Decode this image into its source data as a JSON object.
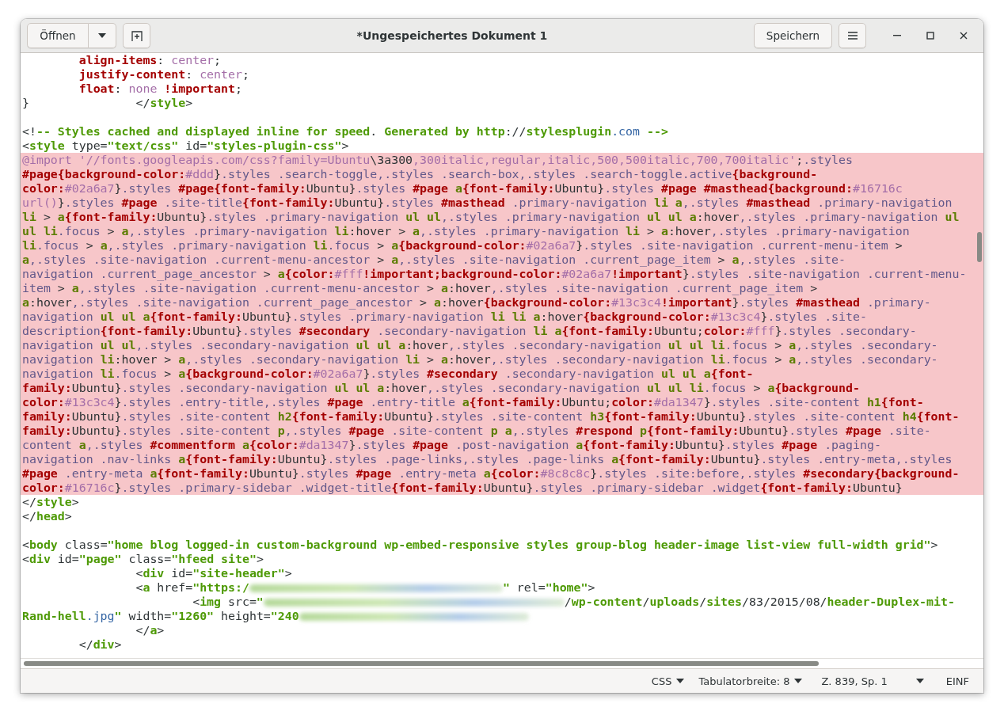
{
  "window": {
    "title": "*Ungespeichertes Dokument 1"
  },
  "header": {
    "open_button": "Öffnen",
    "save_button": "Speichern"
  },
  "editor": {
    "lines": [
      {
        "highlighted": false,
        "segments": [
          {
            "kind": "property",
            "text": "        align-items"
          },
          {
            "kind": "plain",
            "text": ": "
          },
          {
            "kind": "value",
            "text": "center"
          },
          {
            "kind": "plain",
            "text": ";"
          }
        ]
      },
      {
        "highlighted": false,
        "segments": [
          {
            "kind": "property",
            "text": "        justify-content"
          },
          {
            "kind": "plain",
            "text": ": "
          },
          {
            "kind": "value",
            "text": "center"
          },
          {
            "kind": "plain",
            "text": ";"
          }
        ]
      },
      {
        "highlighted": false,
        "segments": [
          {
            "kind": "property",
            "text": "        float"
          },
          {
            "kind": "plain",
            "text": ": "
          },
          {
            "kind": "value",
            "text": "none"
          },
          {
            "kind": "property",
            "text": " !important"
          },
          {
            "kind": "plain",
            "text": ";"
          }
        ]
      },
      {
        "highlighted": false,
        "segments": [
          {
            "kind": "plain",
            "text": "}               </"
          },
          {
            "kind": "markup",
            "text": "style"
          },
          {
            "kind": "plain",
            "text": ">"
          }
        ]
      },
      {
        "highlighted": false
      },
      {
        "highlighted": false,
        "segments": [
          {
            "kind": "plain",
            "text": "<!"
          },
          {
            "kind": "markup",
            "text": "-- Styles cached and displayed inline for speed"
          },
          {
            "kind": "plain",
            "text": "."
          },
          {
            "kind": "markup",
            "text": " Generated by http"
          },
          {
            "kind": "plain",
            "text": "://"
          },
          {
            "kind": "markup",
            "text": "stylesplugin"
          },
          {
            "kind": "link",
            "text": ".com"
          },
          {
            "kind": "markup",
            "text": " -->"
          }
        ]
      },
      {
        "highlighted": false,
        "segments": [
          {
            "kind": "plain",
            "text": "<"
          },
          {
            "kind": "markup",
            "text": "style"
          },
          {
            "kind": "plain",
            "text": " type="
          },
          {
            "kind": "markup",
            "text": "\"text/css\""
          },
          {
            "kind": "plain",
            "text": " id="
          },
          {
            "kind": "markup",
            "text": "\"styles-plugin-css\""
          },
          {
            "kind": "plain",
            "text": ">"
          }
        ]
      },
      {
        "highlighted": true,
        "segments": [
          {
            "kind": "value",
            "text": "@import '//fonts.googleapis.com/css?family=Ubuntu"
          },
          {
            "kind": "plain",
            "text": "\\3a300"
          },
          {
            "kind": "value",
            "text": ",300italic,regular,italic,500,500italic,700,700italic'"
          },
          {
            "kind": "plain",
            "text": ";"
          },
          {
            "kind": "selector",
            "text": ".styles"
          }
        ]
      },
      {
        "highlighted": true,
        "segments": [
          {
            "kind": "property",
            "text": "#page{background-color:"
          },
          {
            "kind": "value",
            "text": "#ddd"
          },
          {
            "kind": "plain",
            "text": "}"
          },
          {
            "kind": "selector",
            "text": ".styles .search-toggle,.styles .search-box,.styles .search-toggle.active"
          },
          {
            "kind": "property",
            "text": "{background-"
          }
        ]
      },
      {
        "highlighted": true,
        "segments": [
          {
            "kind": "property",
            "text": "color:"
          },
          {
            "kind": "value",
            "text": "#02a6a7"
          },
          {
            "kind": "plain",
            "text": "}"
          },
          {
            "kind": "selector",
            "text": ".styles "
          },
          {
            "kind": "property",
            "text": "#page{font-family:"
          },
          {
            "kind": "plain",
            "text": "Ubuntu}"
          },
          {
            "kind": "selector",
            "text": ".styles "
          },
          {
            "kind": "property",
            "text": "#page "
          },
          {
            "kind": "element",
            "text": "a"
          },
          {
            "kind": "property",
            "text": "{font-family:"
          },
          {
            "kind": "plain",
            "text": "Ubuntu}"
          },
          {
            "kind": "selector",
            "text": ".styles "
          },
          {
            "kind": "property",
            "text": "#page #masthead{background:"
          },
          {
            "kind": "value",
            "text": "#16716c"
          }
        ]
      },
      {
        "highlighted": true,
        "segments": [
          {
            "kind": "value",
            "text": "url()"
          },
          {
            "kind": "plain",
            "text": "}"
          },
          {
            "kind": "selector",
            "text": ".styles "
          },
          {
            "kind": "property",
            "text": "#page "
          },
          {
            "kind": "selector",
            "text": ".site-title"
          },
          {
            "kind": "property",
            "text": "{font-family:"
          },
          {
            "kind": "plain",
            "text": "Ubuntu}"
          },
          {
            "kind": "selector",
            "text": ".styles "
          },
          {
            "kind": "property",
            "text": "#masthead "
          },
          {
            "kind": "selector",
            "text": ".primary-navigation "
          },
          {
            "kind": "element",
            "text": "li a"
          },
          {
            "kind": "selector",
            "text": ",.styles "
          },
          {
            "kind": "property",
            "text": "#masthead "
          },
          {
            "kind": "selector",
            "text": ".primary-navigation"
          }
        ]
      },
      {
        "highlighted": true,
        "segments": [
          {
            "kind": "element",
            "text": "li "
          },
          {
            "kind": "plain",
            "text": "> "
          },
          {
            "kind": "element",
            "text": "a"
          },
          {
            "kind": "property",
            "text": "{font-family:"
          },
          {
            "kind": "plain",
            "text": "Ubuntu}"
          },
          {
            "kind": "selector",
            "text": ".styles .primary-navigation "
          },
          {
            "kind": "element",
            "text": "ul ul"
          },
          {
            "kind": "selector",
            "text": ",.styles .primary-navigation "
          },
          {
            "kind": "element",
            "text": "ul ul a"
          },
          {
            "kind": "plain",
            "text": ":hover"
          },
          {
            "kind": "selector",
            "text": ",.styles .primary-navigation "
          },
          {
            "kind": "element",
            "text": "ul"
          }
        ]
      },
      {
        "highlighted": true,
        "segments": [
          {
            "kind": "element",
            "text": "ul li"
          },
          {
            "kind": "selector",
            "text": ".focus "
          },
          {
            "kind": "plain",
            "text": "> "
          },
          {
            "kind": "element",
            "text": "a"
          },
          {
            "kind": "selector",
            "text": ",.styles .primary-navigation "
          },
          {
            "kind": "element",
            "text": "li"
          },
          {
            "kind": "plain",
            "text": ":hover > "
          },
          {
            "kind": "element",
            "text": "a"
          },
          {
            "kind": "selector",
            "text": ",.styles .primary-navigation "
          },
          {
            "kind": "element",
            "text": "li "
          },
          {
            "kind": "plain",
            "text": "> "
          },
          {
            "kind": "element",
            "text": "a"
          },
          {
            "kind": "plain",
            "text": ":hover"
          },
          {
            "kind": "selector",
            "text": ",.styles .primary-navigation"
          }
        ]
      },
      {
        "highlighted": true,
        "segments": [
          {
            "kind": "element",
            "text": "li"
          },
          {
            "kind": "selector",
            "text": ".focus "
          },
          {
            "kind": "plain",
            "text": "> "
          },
          {
            "kind": "element",
            "text": "a"
          },
          {
            "kind": "selector",
            "text": ",.styles .primary-navigation "
          },
          {
            "kind": "element",
            "text": "li"
          },
          {
            "kind": "selector",
            "text": ".focus "
          },
          {
            "kind": "plain",
            "text": "> "
          },
          {
            "kind": "element",
            "text": "a"
          },
          {
            "kind": "property",
            "text": "{background-color:"
          },
          {
            "kind": "value",
            "text": "#02a6a7"
          },
          {
            "kind": "plain",
            "text": "}"
          },
          {
            "kind": "selector",
            "text": ".styles .site-navigation .current-menu-item "
          },
          {
            "kind": "plain",
            "text": ">"
          }
        ]
      },
      {
        "highlighted": true,
        "segments": [
          {
            "kind": "element",
            "text": "a"
          },
          {
            "kind": "selector",
            "text": ",.styles .site-navigation .current-menu-ancestor "
          },
          {
            "kind": "plain",
            "text": "> "
          },
          {
            "kind": "element",
            "text": "a"
          },
          {
            "kind": "selector",
            "text": ",.styles .site-navigation .current_page_item "
          },
          {
            "kind": "plain",
            "text": "> "
          },
          {
            "kind": "element",
            "text": "a"
          },
          {
            "kind": "selector",
            "text": ",.styles .site-"
          }
        ]
      },
      {
        "highlighted": true,
        "segments": [
          {
            "kind": "selector",
            "text": "navigation .current_page_ancestor "
          },
          {
            "kind": "plain",
            "text": "> "
          },
          {
            "kind": "element",
            "text": "a"
          },
          {
            "kind": "property",
            "text": "{color:"
          },
          {
            "kind": "value",
            "text": "#fff"
          },
          {
            "kind": "property",
            "text": "!important;background-color:"
          },
          {
            "kind": "value",
            "text": "#02a6a7"
          },
          {
            "kind": "property",
            "text": "!important"
          },
          {
            "kind": "plain",
            "text": "}"
          },
          {
            "kind": "selector",
            "text": ".styles .site-navigation .current-menu-"
          }
        ]
      },
      {
        "highlighted": true,
        "segments": [
          {
            "kind": "selector",
            "text": "item "
          },
          {
            "kind": "plain",
            "text": "> "
          },
          {
            "kind": "element",
            "text": "a"
          },
          {
            "kind": "selector",
            "text": ",.styles .site-navigation .current-menu-ancestor "
          },
          {
            "kind": "plain",
            "text": "> "
          },
          {
            "kind": "element",
            "text": "a"
          },
          {
            "kind": "plain",
            "text": ":hover"
          },
          {
            "kind": "selector",
            "text": ",.styles .site-navigation .current_page_item "
          },
          {
            "kind": "plain",
            "text": ">"
          }
        ]
      },
      {
        "highlighted": true,
        "segments": [
          {
            "kind": "element",
            "text": "a"
          },
          {
            "kind": "plain",
            "text": ":hover"
          },
          {
            "kind": "selector",
            "text": ",.styles .site-navigation .current_page_ancestor "
          },
          {
            "kind": "plain",
            "text": "> "
          },
          {
            "kind": "element",
            "text": "a"
          },
          {
            "kind": "plain",
            "text": ":hover"
          },
          {
            "kind": "property",
            "text": "{background-color:"
          },
          {
            "kind": "value",
            "text": "#13c3c4"
          },
          {
            "kind": "property",
            "text": "!important"
          },
          {
            "kind": "plain",
            "text": "}"
          },
          {
            "kind": "selector",
            "text": ".styles "
          },
          {
            "kind": "property",
            "text": "#masthead "
          },
          {
            "kind": "selector",
            "text": ".primary-"
          }
        ]
      },
      {
        "highlighted": true,
        "segments": [
          {
            "kind": "selector",
            "text": "navigation "
          },
          {
            "kind": "element",
            "text": "ul ul a"
          },
          {
            "kind": "property",
            "text": "{font-family:"
          },
          {
            "kind": "plain",
            "text": "Ubuntu}"
          },
          {
            "kind": "selector",
            "text": ".styles .primary-navigation "
          },
          {
            "kind": "element",
            "text": "li li a"
          },
          {
            "kind": "plain",
            "text": ":hover"
          },
          {
            "kind": "property",
            "text": "{background-color:"
          },
          {
            "kind": "value",
            "text": "#13c3c4"
          },
          {
            "kind": "plain",
            "text": "}"
          },
          {
            "kind": "selector",
            "text": ".styles .site-"
          }
        ]
      },
      {
        "highlighted": true,
        "segments": [
          {
            "kind": "selector",
            "text": "description"
          },
          {
            "kind": "property",
            "text": "{font-family:"
          },
          {
            "kind": "plain",
            "text": "Ubuntu}"
          },
          {
            "kind": "selector",
            "text": ".styles "
          },
          {
            "kind": "property",
            "text": "#secondary "
          },
          {
            "kind": "selector",
            "text": ".secondary-navigation "
          },
          {
            "kind": "element",
            "text": "li a"
          },
          {
            "kind": "property",
            "text": "{font-family:"
          },
          {
            "kind": "plain",
            "text": "Ubuntu;"
          },
          {
            "kind": "property",
            "text": "color:"
          },
          {
            "kind": "value",
            "text": "#fff"
          },
          {
            "kind": "plain",
            "text": "}"
          },
          {
            "kind": "selector",
            "text": ".styles .secondary-"
          }
        ]
      },
      {
        "highlighted": true,
        "segments": [
          {
            "kind": "selector",
            "text": "navigation "
          },
          {
            "kind": "element",
            "text": "ul ul"
          },
          {
            "kind": "selector",
            "text": ",.styles .secondary-navigation "
          },
          {
            "kind": "element",
            "text": "ul ul a"
          },
          {
            "kind": "plain",
            "text": ":hover"
          },
          {
            "kind": "selector",
            "text": ",.styles .secondary-navigation "
          },
          {
            "kind": "element",
            "text": "ul ul li"
          },
          {
            "kind": "selector",
            "text": ".focus "
          },
          {
            "kind": "plain",
            "text": "> "
          },
          {
            "kind": "element",
            "text": "a"
          },
          {
            "kind": "selector",
            "text": ",.styles .secondary-"
          }
        ]
      },
      {
        "highlighted": true,
        "segments": [
          {
            "kind": "selector",
            "text": "navigation "
          },
          {
            "kind": "element",
            "text": "li"
          },
          {
            "kind": "plain",
            "text": ":hover > "
          },
          {
            "kind": "element",
            "text": "a"
          },
          {
            "kind": "selector",
            "text": ",.styles .secondary-navigation "
          },
          {
            "kind": "element",
            "text": "li "
          },
          {
            "kind": "plain",
            "text": "> "
          },
          {
            "kind": "element",
            "text": "a"
          },
          {
            "kind": "plain",
            "text": ":hover"
          },
          {
            "kind": "selector",
            "text": ",.styles .secondary-navigation "
          },
          {
            "kind": "element",
            "text": "li"
          },
          {
            "kind": "selector",
            "text": ".focus "
          },
          {
            "kind": "plain",
            "text": "> "
          },
          {
            "kind": "element",
            "text": "a"
          },
          {
            "kind": "selector",
            "text": ",.styles .secondary-"
          }
        ]
      },
      {
        "highlighted": true,
        "segments": [
          {
            "kind": "selector",
            "text": "navigation "
          },
          {
            "kind": "element",
            "text": "li"
          },
          {
            "kind": "selector",
            "text": ".focus "
          },
          {
            "kind": "plain",
            "text": "> "
          },
          {
            "kind": "element",
            "text": "a"
          },
          {
            "kind": "property",
            "text": "{background-color:"
          },
          {
            "kind": "value",
            "text": "#02a6a7"
          },
          {
            "kind": "plain",
            "text": "}"
          },
          {
            "kind": "selector",
            "text": ".styles "
          },
          {
            "kind": "property",
            "text": "#secondary "
          },
          {
            "kind": "selector",
            "text": ".secondary-navigation "
          },
          {
            "kind": "element",
            "text": "ul ul a"
          },
          {
            "kind": "property",
            "text": "{font-"
          }
        ]
      },
      {
        "highlighted": true,
        "segments": [
          {
            "kind": "property",
            "text": "family:"
          },
          {
            "kind": "plain",
            "text": "Ubuntu}"
          },
          {
            "kind": "selector",
            "text": ".styles .secondary-navigation "
          },
          {
            "kind": "element",
            "text": "ul ul a"
          },
          {
            "kind": "plain",
            "text": ":hover"
          },
          {
            "kind": "selector",
            "text": ",.styles .secondary-navigation "
          },
          {
            "kind": "element",
            "text": "ul ul li"
          },
          {
            "kind": "selector",
            "text": ".focus "
          },
          {
            "kind": "plain",
            "text": "> "
          },
          {
            "kind": "element",
            "text": "a"
          },
          {
            "kind": "property",
            "text": "{background-"
          }
        ]
      },
      {
        "highlighted": true,
        "segments": [
          {
            "kind": "property",
            "text": "color:"
          },
          {
            "kind": "value",
            "text": "#13c3c4"
          },
          {
            "kind": "plain",
            "text": "}"
          },
          {
            "kind": "selector",
            "text": ".styles .entry-title,.styles "
          },
          {
            "kind": "property",
            "text": "#page "
          },
          {
            "kind": "selector",
            "text": ".entry-title "
          },
          {
            "kind": "element",
            "text": "a"
          },
          {
            "kind": "property",
            "text": "{font-family:"
          },
          {
            "kind": "plain",
            "text": "Ubuntu;"
          },
          {
            "kind": "property",
            "text": "color:"
          },
          {
            "kind": "value",
            "text": "#da1347"
          },
          {
            "kind": "plain",
            "text": "}"
          },
          {
            "kind": "selector",
            "text": ".styles .site-content "
          },
          {
            "kind": "element",
            "text": "h1"
          },
          {
            "kind": "property",
            "text": "{font-"
          }
        ]
      },
      {
        "highlighted": true,
        "segments": [
          {
            "kind": "property",
            "text": "family:"
          },
          {
            "kind": "plain",
            "text": "Ubuntu}"
          },
          {
            "kind": "selector",
            "text": ".styles .site-content "
          },
          {
            "kind": "element",
            "text": "h2"
          },
          {
            "kind": "property",
            "text": "{font-family:"
          },
          {
            "kind": "plain",
            "text": "Ubuntu}"
          },
          {
            "kind": "selector",
            "text": ".styles .site-content "
          },
          {
            "kind": "element",
            "text": "h3"
          },
          {
            "kind": "property",
            "text": "{font-family:"
          },
          {
            "kind": "plain",
            "text": "Ubuntu}"
          },
          {
            "kind": "selector",
            "text": ".styles .site-content "
          },
          {
            "kind": "element",
            "text": "h4"
          },
          {
            "kind": "property",
            "text": "{font-"
          }
        ]
      },
      {
        "highlighted": true,
        "segments": [
          {
            "kind": "property",
            "text": "family:"
          },
          {
            "kind": "plain",
            "text": "Ubuntu}"
          },
          {
            "kind": "selector",
            "text": ".styles .site-content "
          },
          {
            "kind": "element",
            "text": "p"
          },
          {
            "kind": "selector",
            "text": ",.styles "
          },
          {
            "kind": "property",
            "text": "#page "
          },
          {
            "kind": "selector",
            "text": ".site-content "
          },
          {
            "kind": "element",
            "text": "p a"
          },
          {
            "kind": "selector",
            "text": ",.styles "
          },
          {
            "kind": "property",
            "text": "#respond "
          },
          {
            "kind": "element",
            "text": "p"
          },
          {
            "kind": "property",
            "text": "{font-family:"
          },
          {
            "kind": "plain",
            "text": "Ubuntu}"
          },
          {
            "kind": "selector",
            "text": ".styles "
          },
          {
            "kind": "property",
            "text": "#page "
          },
          {
            "kind": "selector",
            "text": ".site-"
          }
        ]
      },
      {
        "highlighted": true,
        "segments": [
          {
            "kind": "selector",
            "text": "content "
          },
          {
            "kind": "element",
            "text": "a"
          },
          {
            "kind": "selector",
            "text": ",.styles "
          },
          {
            "kind": "property",
            "text": "#commentform "
          },
          {
            "kind": "element",
            "text": "a"
          },
          {
            "kind": "property",
            "text": "{color:"
          },
          {
            "kind": "value",
            "text": "#da1347"
          },
          {
            "kind": "plain",
            "text": "}"
          },
          {
            "kind": "selector",
            "text": ".styles "
          },
          {
            "kind": "property",
            "text": "#page "
          },
          {
            "kind": "selector",
            "text": ".post-navigation "
          },
          {
            "kind": "element",
            "text": "a"
          },
          {
            "kind": "property",
            "text": "{font-family:"
          },
          {
            "kind": "plain",
            "text": "Ubuntu}"
          },
          {
            "kind": "selector",
            "text": ".styles "
          },
          {
            "kind": "property",
            "text": "#page "
          },
          {
            "kind": "selector",
            "text": ".paging-"
          }
        ]
      },
      {
        "highlighted": true,
        "segments": [
          {
            "kind": "selector",
            "text": "navigation .nav-links "
          },
          {
            "kind": "element",
            "text": "a"
          },
          {
            "kind": "property",
            "text": "{font-family:"
          },
          {
            "kind": "plain",
            "text": "Ubuntu}"
          },
          {
            "kind": "selector",
            "text": ".styles .page-links,.styles .page-links "
          },
          {
            "kind": "element",
            "text": "a"
          },
          {
            "kind": "property",
            "text": "{font-family:"
          },
          {
            "kind": "plain",
            "text": "Ubuntu}"
          },
          {
            "kind": "selector",
            "text": ".styles .entry-meta,.styles"
          }
        ]
      },
      {
        "highlighted": true,
        "segments": [
          {
            "kind": "property",
            "text": "#page "
          },
          {
            "kind": "selector",
            "text": ".entry-meta "
          },
          {
            "kind": "element",
            "text": "a"
          },
          {
            "kind": "property",
            "text": "{font-family:"
          },
          {
            "kind": "plain",
            "text": "Ubuntu}"
          },
          {
            "kind": "selector",
            "text": ".styles "
          },
          {
            "kind": "property",
            "text": "#page "
          },
          {
            "kind": "selector",
            "text": ".entry-meta "
          },
          {
            "kind": "element",
            "text": "a"
          },
          {
            "kind": "property",
            "text": "{color:"
          },
          {
            "kind": "value",
            "text": "#8c8c8c"
          },
          {
            "kind": "plain",
            "text": "}"
          },
          {
            "kind": "selector",
            "text": ".styles .site:before,.styles "
          },
          {
            "kind": "property",
            "text": "#secondary{background-"
          }
        ]
      },
      {
        "highlighted": true,
        "segments": [
          {
            "kind": "property",
            "text": "color:"
          },
          {
            "kind": "value",
            "text": "#16716c"
          },
          {
            "kind": "plain",
            "text": "}"
          },
          {
            "kind": "selector",
            "text": ".styles .primary-sidebar .widget-title"
          },
          {
            "kind": "property",
            "text": "{font-family:"
          },
          {
            "kind": "plain",
            "text": "Ubuntu}"
          },
          {
            "kind": "selector",
            "text": ".styles .primary-sidebar .widget"
          },
          {
            "kind": "property",
            "text": "{font-family:"
          },
          {
            "kind": "plain",
            "text": "Ubuntu}"
          }
        ]
      },
      {
        "highlighted": false,
        "segments": [
          {
            "kind": "plain",
            "text": "</"
          },
          {
            "kind": "markup",
            "text": "style"
          },
          {
            "kind": "plain",
            "text": ">"
          }
        ]
      },
      {
        "highlighted": false,
        "segments": [
          {
            "kind": "plain",
            "text": "</"
          },
          {
            "kind": "markup",
            "text": "head"
          },
          {
            "kind": "plain",
            "text": ">"
          }
        ]
      },
      {
        "highlighted": false
      },
      {
        "highlighted": false,
        "segments": [
          {
            "kind": "plain",
            "text": "<"
          },
          {
            "kind": "markup",
            "text": "body"
          },
          {
            "kind": "plain",
            "text": " class="
          },
          {
            "kind": "markup",
            "text": "\"home blog logged-in custom-background wp-embed-responsive styles group-blog header-image list-view full-width grid\""
          },
          {
            "kind": "plain",
            "text": ">"
          }
        ]
      },
      {
        "highlighted": false,
        "segments": [
          {
            "kind": "plain",
            "text": "<"
          },
          {
            "kind": "markup",
            "text": "div"
          },
          {
            "kind": "plain",
            "text": " id="
          },
          {
            "kind": "markup",
            "text": "\"page\""
          },
          {
            "kind": "plain",
            "text": " class="
          },
          {
            "kind": "markup",
            "text": "\"hfeed site\""
          },
          {
            "kind": "plain",
            "text": ">"
          }
        ]
      },
      {
        "highlighted": false,
        "segments": [
          {
            "kind": "plain",
            "text": "                <"
          },
          {
            "kind": "markup",
            "text": "div"
          },
          {
            "kind": "plain",
            "text": " id="
          },
          {
            "kind": "markup",
            "text": "\"site-header\""
          },
          {
            "kind": "plain",
            "text": ">"
          }
        ]
      },
      {
        "highlighted": false,
        "segments": [
          {
            "kind": "plain",
            "text": "                <"
          },
          {
            "kind": "markup",
            "text": "a"
          },
          {
            "kind": "plain",
            "text": " href="
          },
          {
            "kind": "markup",
            "text": "\"https:/"
          },
          {
            "kind": "redacted"
          },
          {
            "kind": "markup",
            "text": "\""
          },
          {
            "kind": "plain",
            "text": " rel="
          },
          {
            "kind": "markup",
            "text": "\"home\""
          },
          {
            "kind": "plain",
            "text": ">"
          }
        ]
      },
      {
        "highlighted": false,
        "segments": [
          {
            "kind": "plain",
            "text": "                        <"
          },
          {
            "kind": "markup",
            "text": "img"
          },
          {
            "kind": "plain",
            "text": " src="
          },
          {
            "kind": "markup",
            "text": "\""
          },
          {
            "kind": "redacted"
          },
          {
            "kind": "plain",
            "text": "/"
          },
          {
            "kind": "markup",
            "text": "wp-content"
          },
          {
            "kind": "plain",
            "text": "/"
          },
          {
            "kind": "markup",
            "text": "uploads"
          },
          {
            "kind": "plain",
            "text": "/"
          },
          {
            "kind": "markup",
            "text": "sites"
          },
          {
            "kind": "plain",
            "text": "/83/2015/08/"
          },
          {
            "kind": "markup",
            "text": "header-Duplex-mit-"
          }
        ]
      },
      {
        "highlighted": false,
        "segments": [
          {
            "kind": "markup",
            "text": "Rand-hell"
          },
          {
            "kind": "link",
            "text": ".jpg"
          },
          {
            "kind": "markup",
            "text": "\""
          },
          {
            "kind": "plain",
            "text": " width="
          },
          {
            "kind": "markup",
            "text": "\"1260\""
          },
          {
            "kind": "plain",
            "text": " height="
          },
          {
            "kind": "markup",
            "text": "\"240"
          },
          {
            "kind": "redacted"
          }
        ]
      },
      {
        "highlighted": false,
        "segments": [
          {
            "kind": "plain",
            "text": "                </"
          },
          {
            "kind": "markup",
            "text": "a"
          },
          {
            "kind": "plain",
            "text": ">"
          }
        ]
      },
      {
        "highlighted": false,
        "segments": [
          {
            "kind": "plain",
            "text": "        </"
          },
          {
            "kind": "markup",
            "text": "div"
          },
          {
            "kind": "plain",
            "text": ">"
          }
        ]
      }
    ]
  },
  "status_bar": {
    "language": "CSS",
    "tab_width": "Tabulatorbreite: 8",
    "position": "Z. 839, Sp. 1",
    "mode": "EINF"
  }
}
